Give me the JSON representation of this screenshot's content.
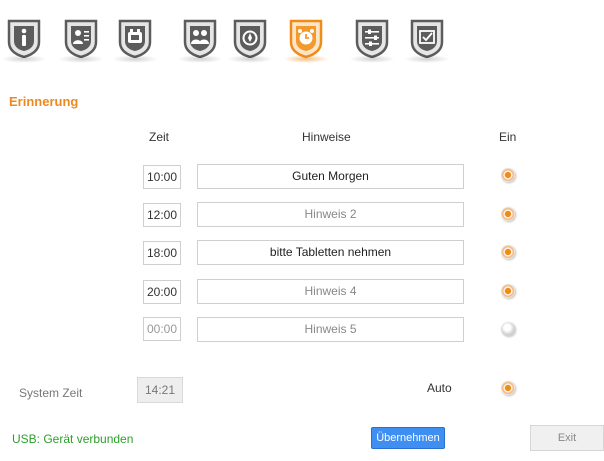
{
  "toolbar": {
    "icons": [
      {
        "name": "info-icon",
        "active": false
      },
      {
        "name": "contact-card-icon",
        "active": false
      },
      {
        "name": "phone-icon",
        "active": false
      },
      {
        "name": "users-icon",
        "active": false
      },
      {
        "name": "emergency-call-icon",
        "active": false
      },
      {
        "name": "alarm-clock-icon",
        "active": true
      },
      {
        "name": "settings-sliders-icon",
        "active": false
      },
      {
        "name": "checklist-icon",
        "active": false
      }
    ]
  },
  "section_title": "Erinnerung",
  "headers": {
    "time": "Zeit",
    "hints": "Hinweise",
    "on": "Ein"
  },
  "reminders": [
    {
      "time": "10:00",
      "hint": "Guten Morgen",
      "enabled": true
    },
    {
      "time": "12:00",
      "hint": "Hinweis 2",
      "enabled": true
    },
    {
      "time": "18:00",
      "hint": "bitte Tabletten nehmen",
      "enabled": true
    },
    {
      "time": "20:00",
      "hint": "Hinweis 4",
      "enabled": true
    },
    {
      "time": "00:00",
      "hint": "Hinweis 5",
      "enabled": false
    }
  ],
  "system": {
    "label": "System Zeit",
    "time": "14:21",
    "auto_label": "Auto",
    "auto_enabled": true
  },
  "footer": {
    "status": "USB: Gerät verbunden",
    "apply_label": "Übernehmen",
    "exit_label": "Exit"
  },
  "colors": {
    "accent": "#ee8a1d",
    "status_ok": "#2ca02c",
    "button_blue": "#3f8ef2"
  }
}
